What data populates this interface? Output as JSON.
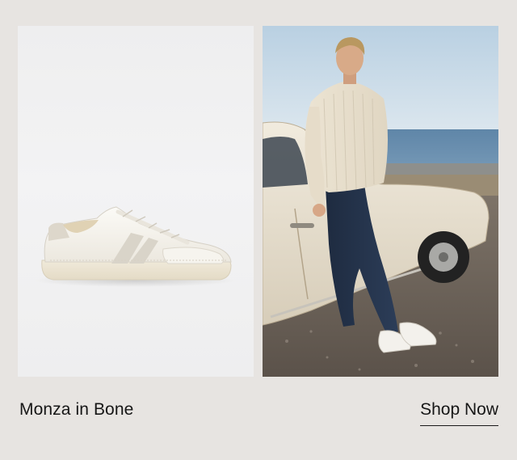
{
  "product": {
    "name": "Monza in Bone"
  },
  "cta": {
    "label": "Shop Now"
  },
  "images": {
    "left": "sneaker-product-photo",
    "right": "model-with-vintage-car-photo"
  },
  "colors": {
    "background": "#e7e4e1",
    "text": "#161616",
    "sneaker": "#f4f1ea"
  }
}
